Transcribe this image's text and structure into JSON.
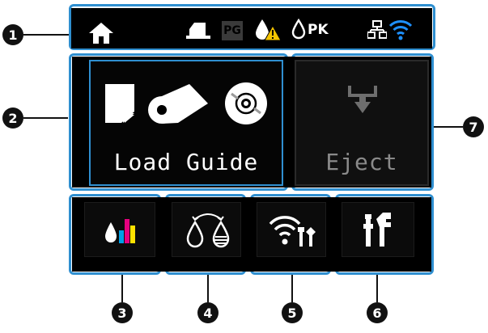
{
  "callouts": [
    "1",
    "2",
    "3",
    "4",
    "5",
    "6",
    "7"
  ],
  "status_bar": {
    "home_icon": "home-icon",
    "icons": [
      "paper-feed-icon",
      "photo-glossy-icon",
      "ink-warning-icon",
      "photo-black-ink-icon",
      "network-icon",
      "wifi-icon"
    ],
    "pg_label": "PG",
    "pk_label": "PK"
  },
  "load_guide": {
    "label": "Load Guide",
    "icons": [
      "cut-sheet-icon",
      "roll-paper-icon",
      "cd-dvd-icon"
    ]
  },
  "eject": {
    "label": "Eject",
    "icon": "eject-arrow-icon"
  },
  "bottom_buttons": [
    {
      "name": "ink-levels-button",
      "icon": "ink-levels-icon"
    },
    {
      "name": "black-ink-switch-button",
      "icon": "black-ink-switch-icon"
    },
    {
      "name": "network-settings-button",
      "icon": "network-settings-icon"
    },
    {
      "name": "maintenance-button",
      "icon": "maintenance-icon"
    }
  ],
  "colors": {
    "frame": "#2f8fd0",
    "warning": "#f4c400",
    "wifi": "#1e90ff",
    "ink_cyan": "#00a0e6",
    "ink_magenta": "#e6007e",
    "ink_yellow": "#ffe100"
  }
}
